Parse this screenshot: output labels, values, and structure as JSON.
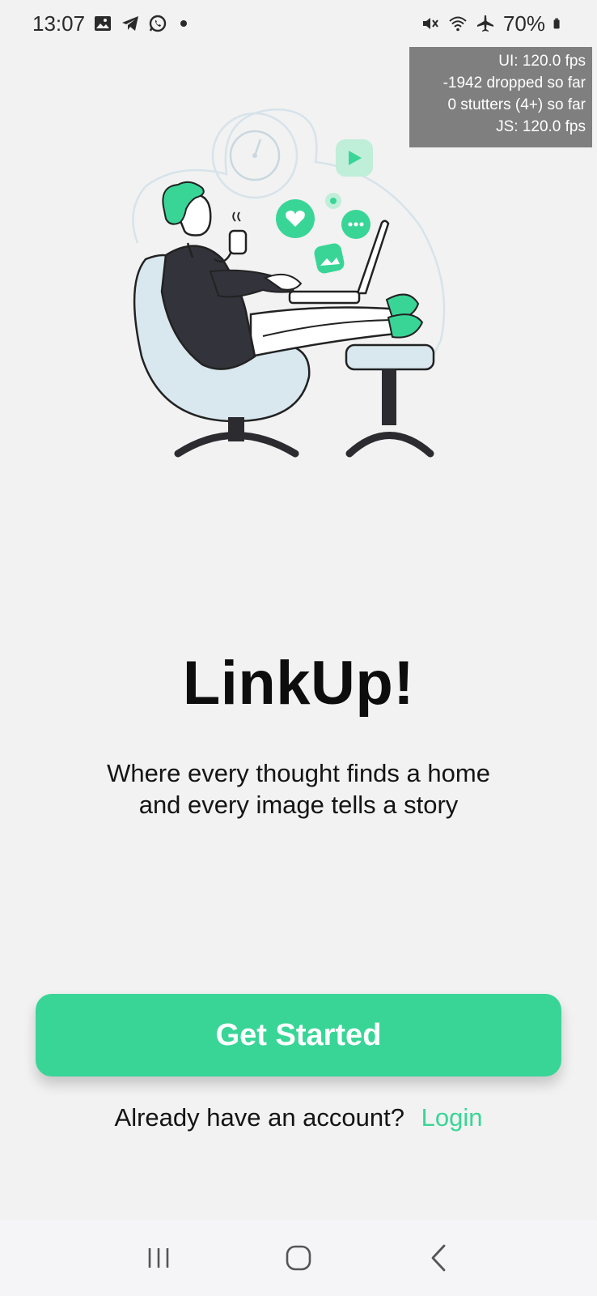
{
  "status_bar": {
    "time": "13:07",
    "battery": "70%",
    "icons_left": [
      "gallery-icon",
      "telegram-icon",
      "whatsapp-icon"
    ],
    "icons_right": [
      "mute-icon",
      "wifi-icon",
      "airplane-icon",
      "battery-icon"
    ]
  },
  "perf_overlay": {
    "ui_fps": "UI: 120.0 fps",
    "dropped": "-1942 dropped so far",
    "stutters": "0 stutters (4+) so far",
    "js_fps": "JS: 120.0 fps"
  },
  "onboarding": {
    "title": "LinkUp!",
    "subtitle_line1": "Where every thought finds a home",
    "subtitle_line2": "and every image tells a story",
    "cta_label": "Get Started",
    "login_prompt": "Already have an account?",
    "login_link": "Login"
  },
  "colors": {
    "accent": "#39d597",
    "background": "#f2f2f2",
    "text": "#111111"
  }
}
